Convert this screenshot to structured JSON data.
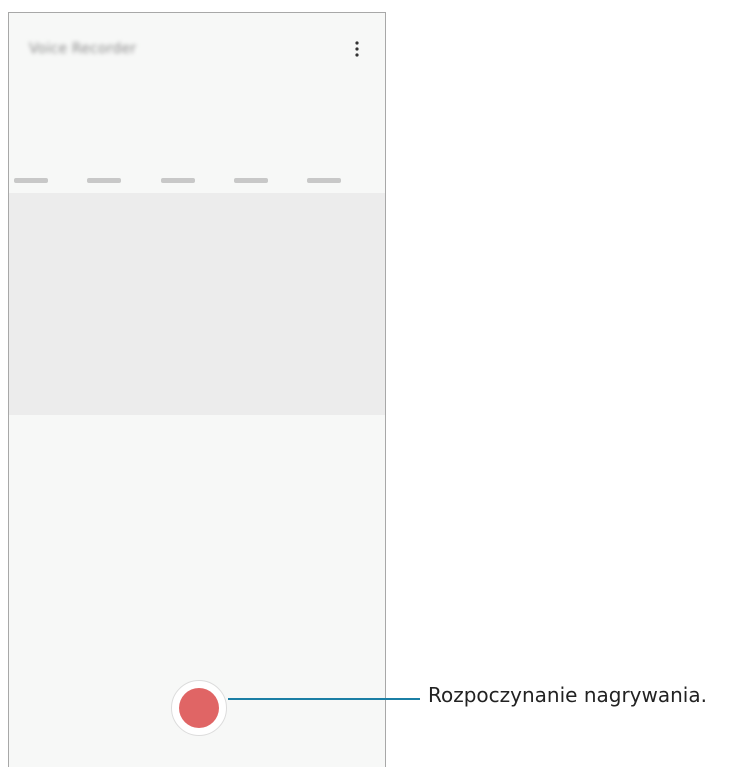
{
  "app": {
    "title": "Voice Recorder"
  },
  "toolbar": {
    "more_icon": "more-vert-icon"
  },
  "timeline": {
    "labels": [
      "",
      "",
      "",
      "",
      ""
    ]
  },
  "controls": {
    "record_icon": "record-icon",
    "record_color": "#e06565"
  },
  "callout": {
    "text": "Rozpoczynanie nagrywania.",
    "line_color": "#1b7fa5"
  }
}
